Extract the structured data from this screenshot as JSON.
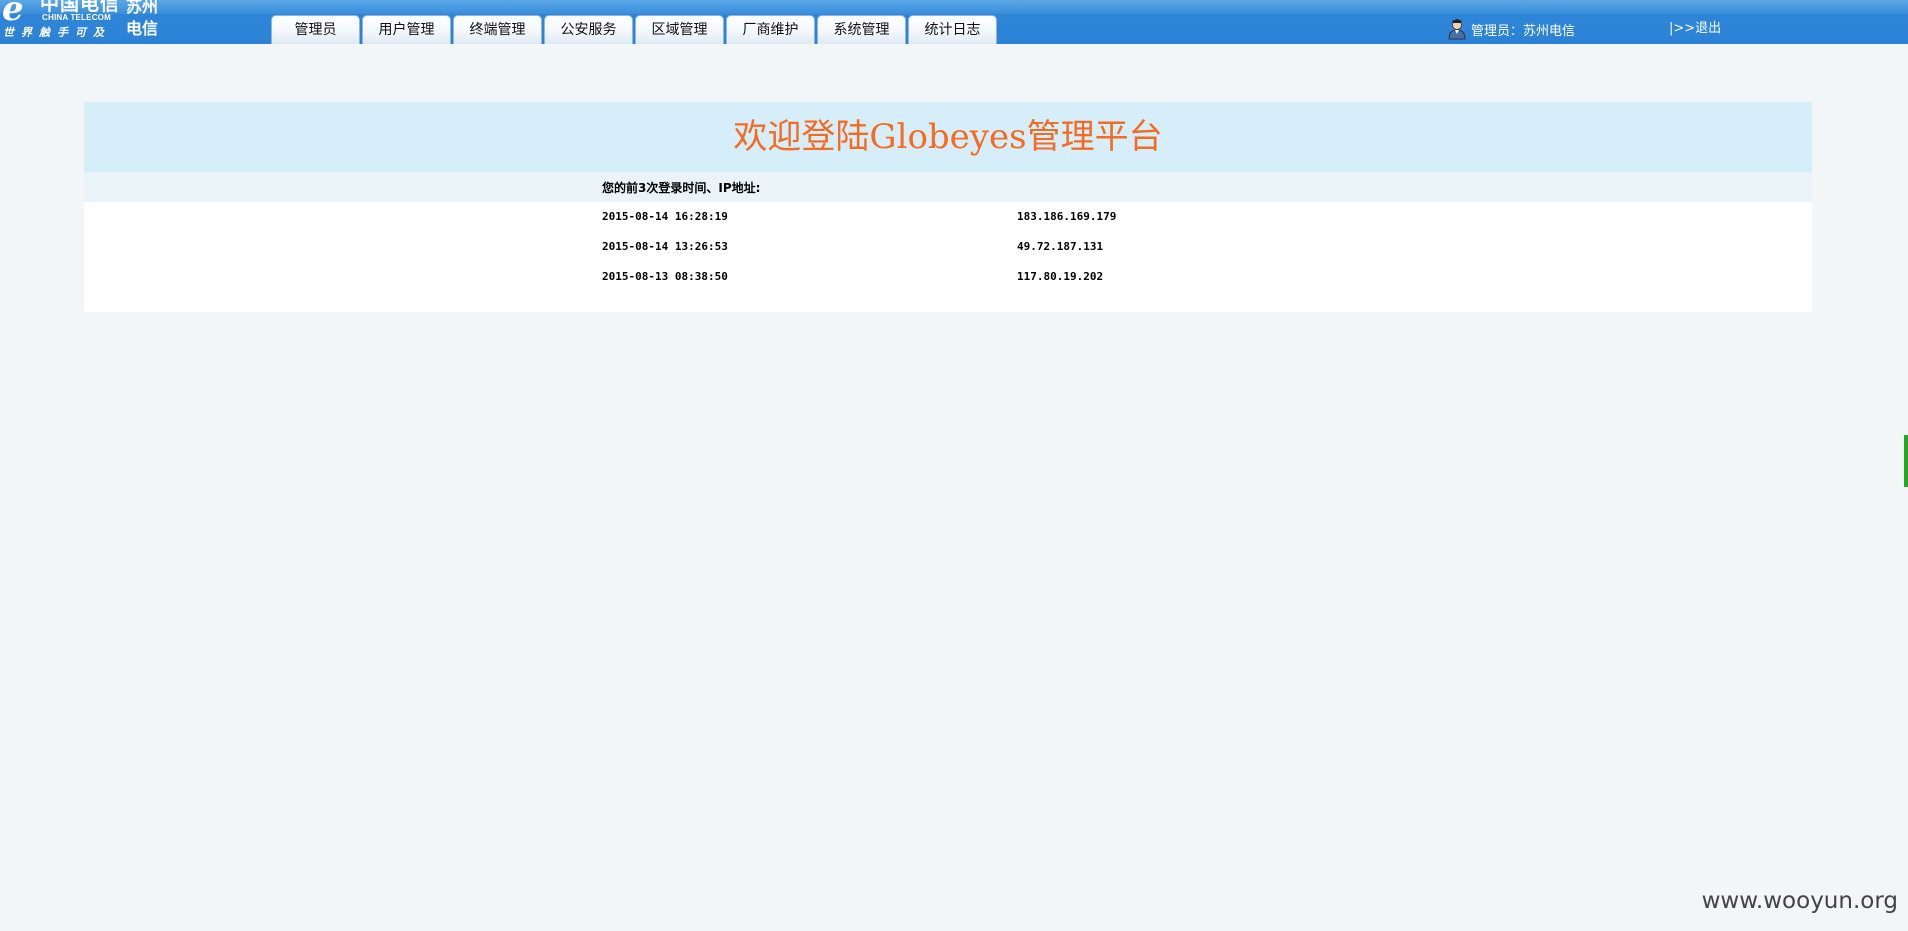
{
  "header": {
    "logo": {
      "mark": "e",
      "cn": "中国电信",
      "en": "CHINA TELECOM",
      "slogan": "世界触手可及",
      "city": "苏州电信"
    },
    "nav": [
      "管理员",
      "用户管理",
      "终端管理",
      "公安服务",
      "区域管理",
      "厂商维护",
      "系统管理",
      "统计日志"
    ],
    "user_label": "管理员：苏州电信",
    "logout": "|>>退出"
  },
  "main": {
    "title": "欢迎登陆Globeyes管理平台",
    "subtitle": "您的前3次登录时间、IP地址:",
    "logins": [
      {
        "time": "2015-08-14 16:28:19",
        "ip": "183.186.169.179"
      },
      {
        "time": "2015-08-14 13:26:53",
        "ip": "49.72.187.131"
      },
      {
        "time": "2015-08-13 08:38:50",
        "ip": "117.80.19.202"
      }
    ]
  },
  "watermark": "www.wooyun.org",
  "colors": {
    "header_blue": "#2f86d8",
    "title_orange": "#f56b21",
    "title_band": "#d6eef9",
    "page_bg": "#f2f6f7"
  }
}
